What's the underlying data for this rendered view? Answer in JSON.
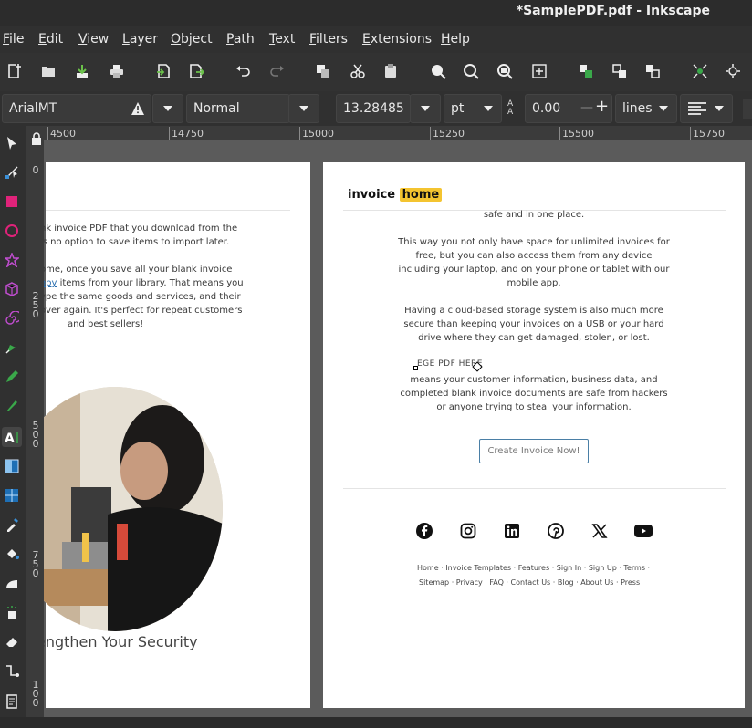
{
  "window": {
    "title": "*SamplePDF.pdf - Inkscape"
  },
  "menu": [
    {
      "label": "File",
      "u": "F",
      "rest": "ile"
    },
    {
      "label": "Edit",
      "u": "E",
      "rest": "dit"
    },
    {
      "label": "View",
      "u": "V",
      "rest": "iew"
    },
    {
      "label": "Layer",
      "u": "L",
      "rest": "ayer"
    },
    {
      "label": "Object",
      "u": "O",
      "rest": "bject"
    },
    {
      "label": "Path",
      "u": "P",
      "rest": "ath"
    },
    {
      "label": "Text",
      "u": "T",
      "rest": "ext"
    },
    {
      "label": "Filters",
      "u": "F",
      "rest": "ilters"
    },
    {
      "label": "Extensions",
      "u": "E",
      "rest": "xtensions"
    },
    {
      "label": "Help",
      "u": "H",
      "rest": "elp"
    }
  ],
  "textbar": {
    "font_family": "ArialMT",
    "font_style": "Normal",
    "font_size": "13.28485",
    "unit": "pt",
    "letter_spacing": "0.00",
    "line_spacing_mode": "lines"
  },
  "ruler_top": [
    "4500",
    "14750",
    "15000",
    "15250",
    "15500",
    "15750"
  ],
  "ruler_left": [
    "0",
    "2 5 0",
    "5 0 0",
    "7 5 0",
    "1 0 0"
  ],
  "page1": {
    "paragraph1": [
      "nk invoice PDF that you download from the",
      "is no option to save items to import later."
    ],
    "paragraph2_line1": "ome, once you save all your blank invoice",
    "paragraph2_link": "opy",
    "paragraph2_line2_rest": " items from your library. That means you",
    "paragraph2_rest": [
      "ype the same goods and services, and their",
      "over again. It's perfect for repeat customers",
      "and best sellers!"
    ],
    "section_title": "engthen Your Security"
  },
  "page2": {
    "logo_left": "invoice",
    "logo_right": "home",
    "line0": "safe and in one place.",
    "paragraph1": [
      "This way you not only have space for unlimited invoices for",
      "free, but you can also access them from any device",
      "including your laptop, and on your phone or tablet with our",
      "mobile app."
    ],
    "paragraph2": [
      "Having a cloud-based storage system is also much more",
      "secure than keeping your invoices on a USB or your hard",
      "drive where they can get damaged, stolen, or lost."
    ],
    "selected_text": "EGE PDF HERE",
    "paragraph3": [
      "means your customer information, business data, and",
      "completed blank invoice documents are safe from hackers",
      "or anyone trying to steal your information."
    ],
    "cta": "Create Invoice Now!",
    "footer_row1": [
      "Home",
      "·",
      "Invoice Templates",
      "·",
      "Features",
      "·",
      "Sign In",
      "·",
      "Sign Up",
      "·",
      "Terms",
      "·"
    ],
    "footer_row2": [
      "Sitemap",
      "·",
      "Privacy",
      "·",
      "FAQ",
      "·",
      "Contact Us",
      "·",
      "Blog",
      "·",
      "About Us",
      "·",
      "Press"
    ]
  },
  "colors": {
    "accent_yellow": "#f4c430",
    "link_blue": "#2a6fb0",
    "cta_border": "#4a7fa6"
  }
}
